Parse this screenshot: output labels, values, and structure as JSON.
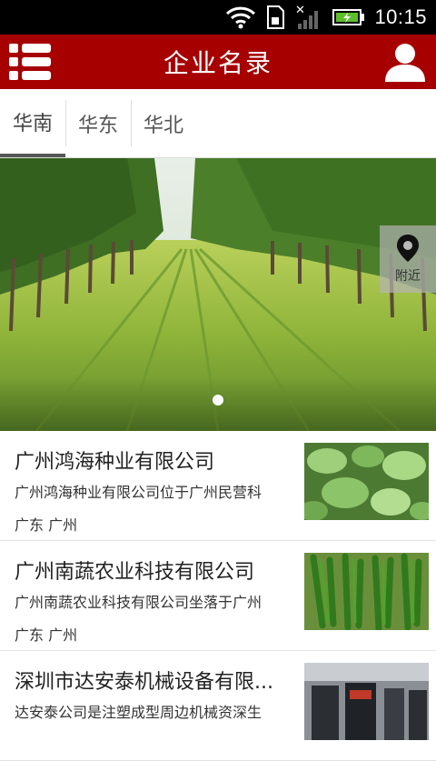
{
  "status_bar": {
    "time": "10:15"
  },
  "header": {
    "title": "企业名录"
  },
  "tabs": [
    {
      "label": "华南",
      "active": true
    },
    {
      "label": "华东",
      "active": false
    },
    {
      "label": "华北",
      "active": false
    }
  ],
  "banner": {
    "nearby_label": "附近"
  },
  "companies": [
    {
      "name": "广州鸿海种业有限公司",
      "desc": "广州鸿海种业有限公司位于广州民营科",
      "location": "广东 广州",
      "thumb": "leaves-photo"
    },
    {
      "name": "广州南蔬农业科技有限公司",
      "desc": "广州南蔬农业科技有限公司坐落于广州",
      "location": "广东 广州",
      "thumb": "peppers-photo"
    },
    {
      "name": "深圳市达安泰机械设备有限...",
      "desc": "达安泰公司是注塑成型周边机械资深生",
      "location": "",
      "thumb": "machinery-photo"
    }
  ],
  "colors": {
    "header_bg": "#a60000",
    "status_bg": "#000000"
  }
}
